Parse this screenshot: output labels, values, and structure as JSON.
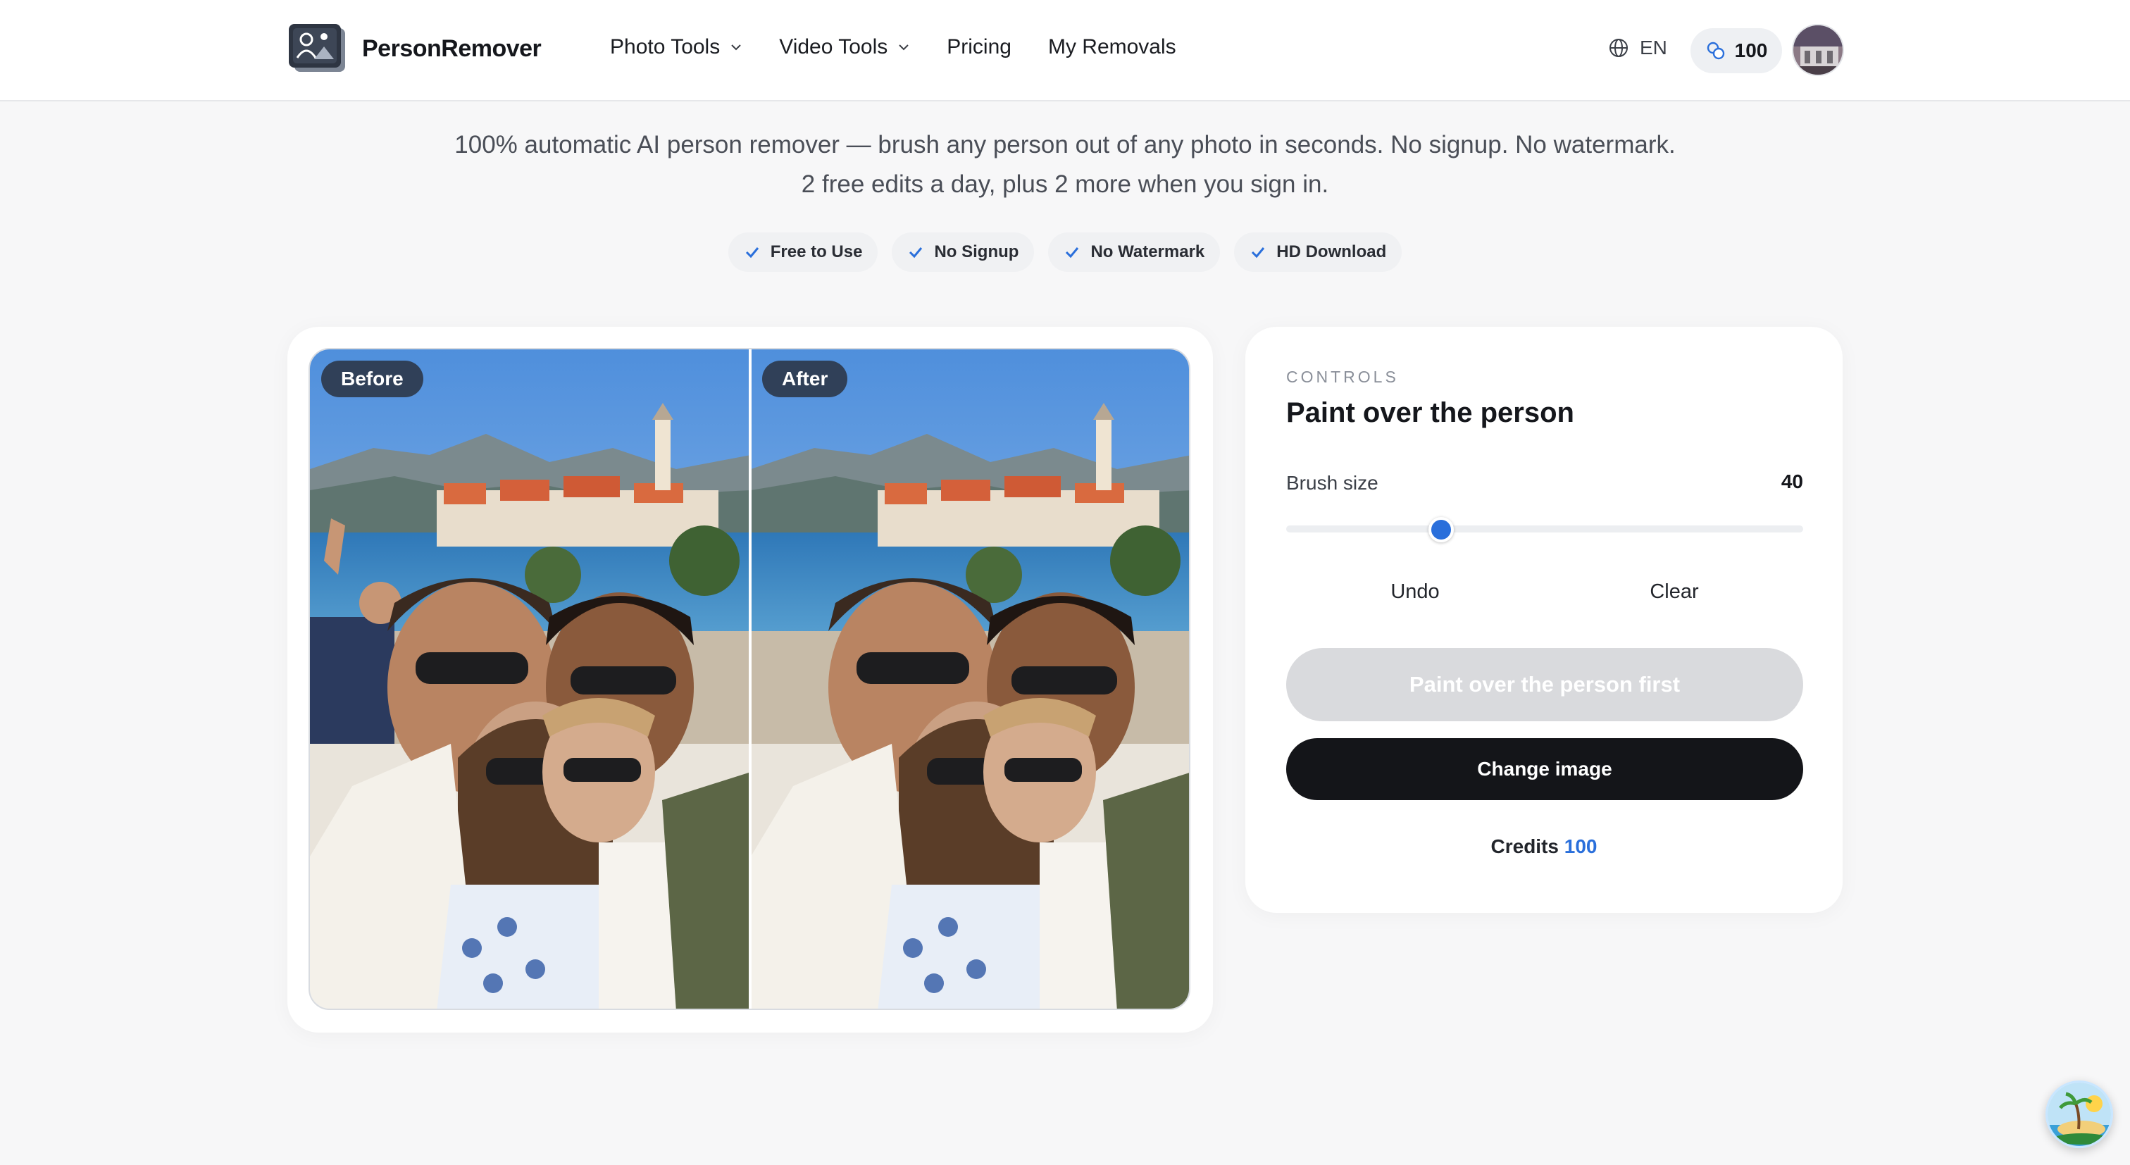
{
  "header": {
    "brand": "PersonRemover",
    "nav": [
      {
        "label": "Photo Tools",
        "dropdown": true
      },
      {
        "label": "Video Tools",
        "dropdown": true
      },
      {
        "label": "Pricing",
        "dropdown": false
      },
      {
        "label": "My Removals",
        "dropdown": false
      }
    ],
    "language": "EN",
    "credits": "100"
  },
  "intro": {
    "line1": "100% automatic AI person remover — brush any person out of any photo in seconds. No signup. No watermark.",
    "line2": "2 free edits a day, plus 2 more when you sign in.",
    "badges": [
      "Free to Use",
      "No Signup",
      "No Watermark",
      "HD Download"
    ]
  },
  "compare": {
    "before_label": "Before",
    "after_label": "After"
  },
  "controls": {
    "eyebrow": "CONTROLS",
    "title": "Paint over the person",
    "brush_label": "Brush size",
    "brush_value": "40",
    "brush_fraction": 0.3,
    "undo_label": "Undo",
    "clear_label": "Clear",
    "primary_label": "Paint over the person first",
    "change_label": "Change image",
    "credits_label": "Credits",
    "credits_value": "100"
  },
  "colors": {
    "accent": "#2a6fdb",
    "dark_button": "#141519",
    "disabled_button": "#d9dadd",
    "page_bg": "#f7f7f8"
  },
  "icons": {
    "logo": "photo-person-icon",
    "nav_dropdown": "chevron-down-icon",
    "language": "globe-icon",
    "credits": "coins-icon",
    "badge": "check-icon",
    "floating": "beach-island-icon"
  }
}
